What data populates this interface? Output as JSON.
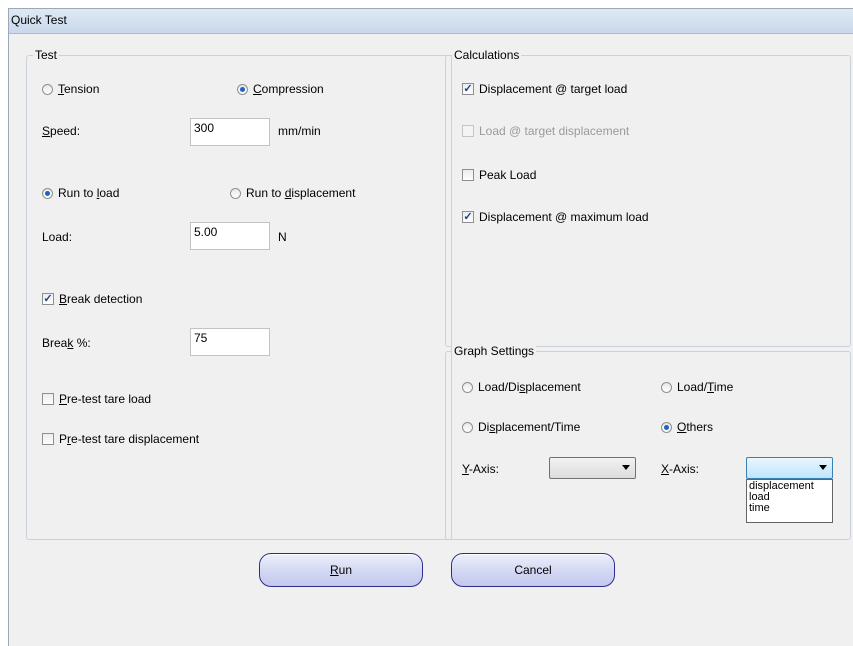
{
  "window": {
    "title": "Quick Test"
  },
  "test": {
    "group_label": "Test",
    "mode": {
      "tension_pre": "",
      "tension_key": "T",
      "tension_post": "ension",
      "compression_pre": "",
      "compression_key": "C",
      "compression_post": "ompression",
      "selected": "compression"
    },
    "speed": {
      "label_pre": "",
      "label_key": "S",
      "label_post": "peed:",
      "value": "300",
      "unit": "mm/min"
    },
    "run_mode": {
      "load_pre": "Run to ",
      "load_key": "l",
      "load_post": "oad",
      "disp_pre": "Run to ",
      "disp_key": "d",
      "disp_post": "isplacement",
      "selected": "load"
    },
    "load": {
      "label": "Load:",
      "value": "5.00",
      "unit": "N"
    },
    "break_detection": {
      "pre": "",
      "key": "B",
      "post": "reak detection",
      "checked": true
    },
    "break_pct": {
      "label_pre": "Brea",
      "label_key": "k",
      "label_post": " %:",
      "value": "75"
    },
    "pretest_tare_load": {
      "pre": "",
      "key": "P",
      "post": "re-test tare load",
      "checked": false
    },
    "pretest_tare_disp": {
      "pre": "P",
      "key": "r",
      "post": "e-test tare displacement",
      "checked": false
    }
  },
  "calculations": {
    "group_label": "Calculations",
    "items": [
      {
        "label": "Displacement @ target load",
        "checked": true,
        "enabled": true
      },
      {
        "label": "Load @ target displacement",
        "checked": false,
        "enabled": false
      },
      {
        "label": "Peak Load",
        "checked": false,
        "enabled": true
      },
      {
        "label": "Displacement @ maximum load",
        "checked": true,
        "enabled": true
      }
    ]
  },
  "graph": {
    "group_label": "Graph Settings",
    "load_disp": {
      "pre": "Load/Di",
      "key": "s",
      "post": "placement"
    },
    "load_time": {
      "pre": "Load/",
      "key": "T",
      "post": "ime"
    },
    "disp_time": {
      "pre": "Di",
      "key": "s",
      "post": "placement/Time"
    },
    "others": {
      "pre": "",
      "key": "O",
      "post": "thers"
    },
    "selected": "others",
    "y_axis": {
      "label_pre": "",
      "label_key": "Y",
      "label_post": "-Axis:",
      "value": ""
    },
    "x_axis": {
      "label_pre": "",
      "label_key": "X",
      "label_post": "-Axis:",
      "value": "",
      "options": [
        "displacement",
        "load",
        "time"
      ]
    }
  },
  "buttons": {
    "run": {
      "pre": "",
      "key": "R",
      "post": "un"
    },
    "cancel": {
      "label": "Cancel"
    }
  }
}
